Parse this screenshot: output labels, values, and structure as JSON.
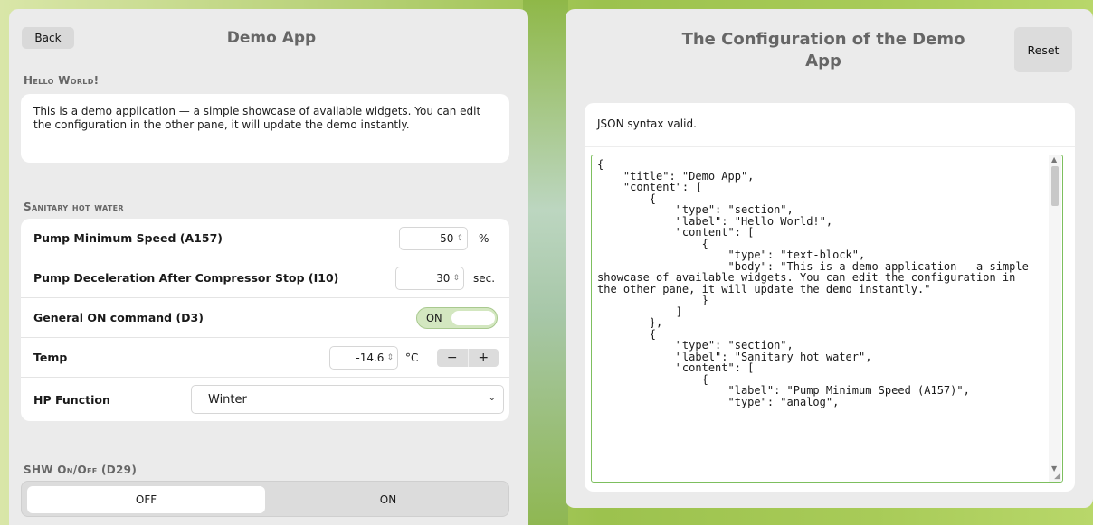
{
  "left": {
    "back_label": "Back",
    "title": "Demo App",
    "section1_label": "Hello World!",
    "text_block": "This is a demo application — a simple showcase of available widgets. You can edit the configuration in the other pane, it will update the demo instantly.",
    "section2_label": "Sanitary hot water",
    "rows": {
      "pump_speed": {
        "label": "Pump Minimum Speed (A157)",
        "value": "50",
        "unit": "%"
      },
      "pump_decel": {
        "label": "Pump Deceleration After Compressor Stop (I10)",
        "value": "30",
        "unit": "sec."
      },
      "general_on": {
        "label": "General ON command (D3)",
        "state": "ON"
      },
      "temp": {
        "label": "Temp",
        "value": "-14.6",
        "unit": "°C",
        "minus": "−",
        "plus": "+"
      },
      "hp_function": {
        "label": "HP Function",
        "value": "Winter"
      }
    },
    "section3_label": "SHW On/Off (D29)",
    "shw_toggle": {
      "off_label": "OFF",
      "on_label": "ON",
      "selected": "OFF"
    }
  },
  "right": {
    "title": "The Configuration of the Demo App",
    "reset_label": "Reset",
    "status": "JSON syntax valid.",
    "json_text": "{\n    \"title\": \"Demo App\",\n    \"content\": [\n        {\n            \"type\": \"section\",\n            \"label\": \"Hello World!\",\n            \"content\": [\n                {\n                    \"type\": \"text-block\",\n                    \"body\": \"This is a demo application — a simple showcase of available widgets. You can edit the configuration in the other pane, it will update the demo instantly.\"\n                }\n            ]\n        },\n        {\n            \"type\": \"section\",\n            \"label\": \"Sanitary hot water\",\n            \"content\": [\n                {\n                    \"label\": \"Pump Minimum Speed (A157)\",\n                    \"type\": \"analog\","
  },
  "icons": {
    "spinner": "spinner-icon",
    "chevron": "chevron-down-icon",
    "scroll": "scrollbar"
  }
}
